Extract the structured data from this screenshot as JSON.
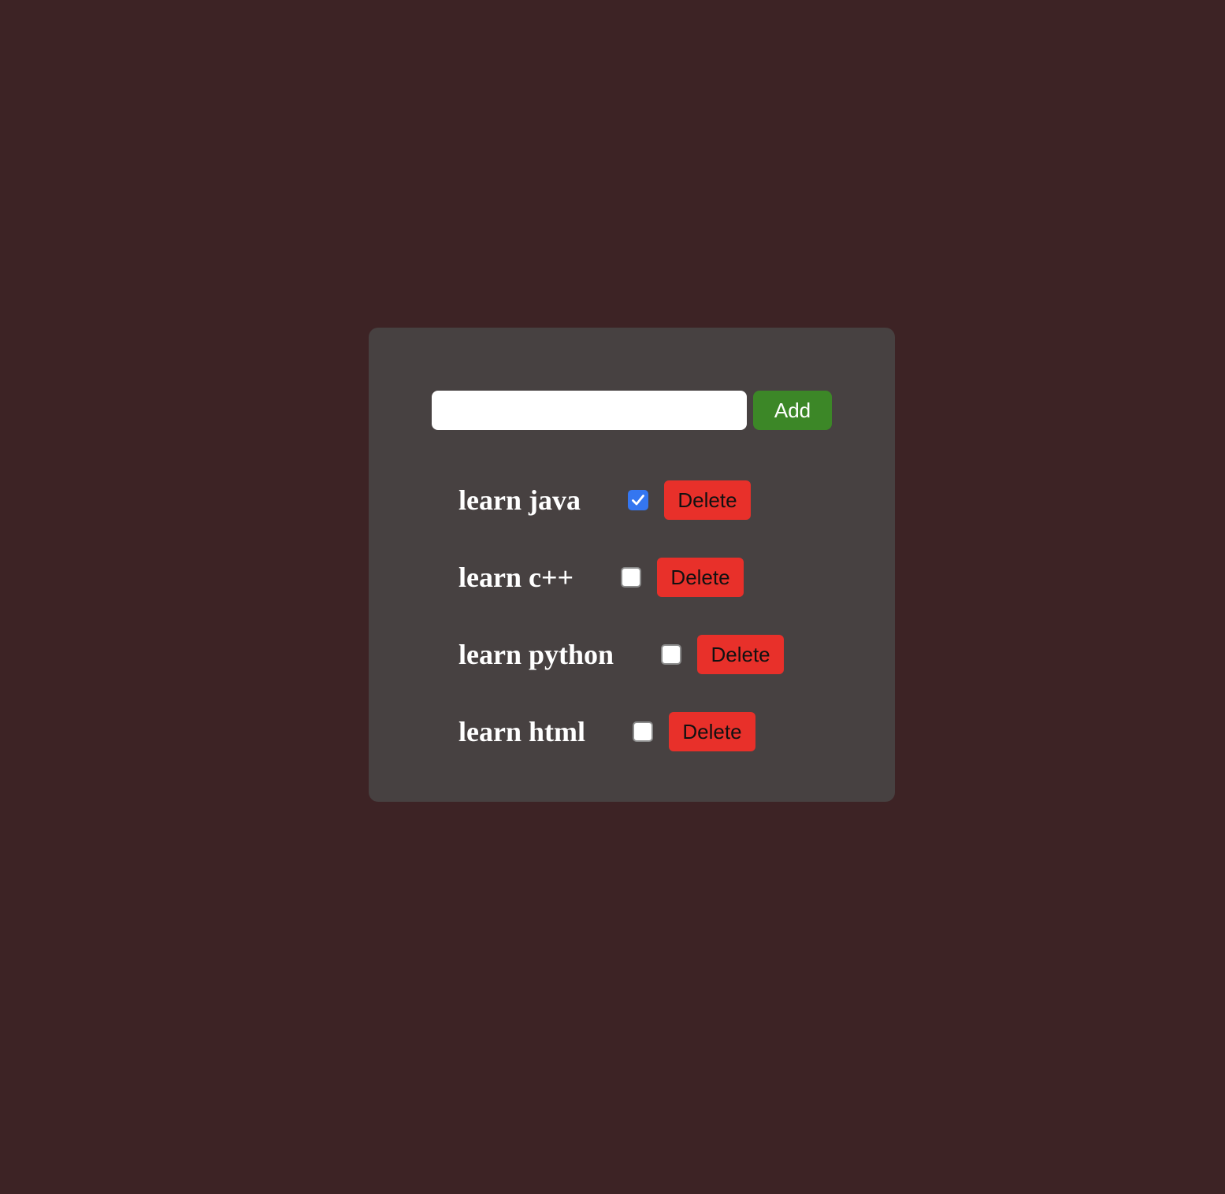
{
  "input": {
    "value": "",
    "placeholder": ""
  },
  "add_button": {
    "label": "Add"
  },
  "todos": [
    {
      "label": "learn java",
      "checked": true,
      "delete_label": "Delete"
    },
    {
      "label": "learn c++",
      "checked": false,
      "delete_label": "Delete"
    },
    {
      "label": "learn python",
      "checked": false,
      "delete_label": "Delete"
    },
    {
      "label": "learn html",
      "checked": false,
      "delete_label": "Delete"
    }
  ],
  "colors": {
    "background": "#3d2325",
    "card": "#474141",
    "add_button": "#3c8727",
    "delete_button": "#e8302a",
    "checkbox_checked": "#3476f0"
  },
  "icons": {
    "checked_state": "checkmark-icon"
  }
}
